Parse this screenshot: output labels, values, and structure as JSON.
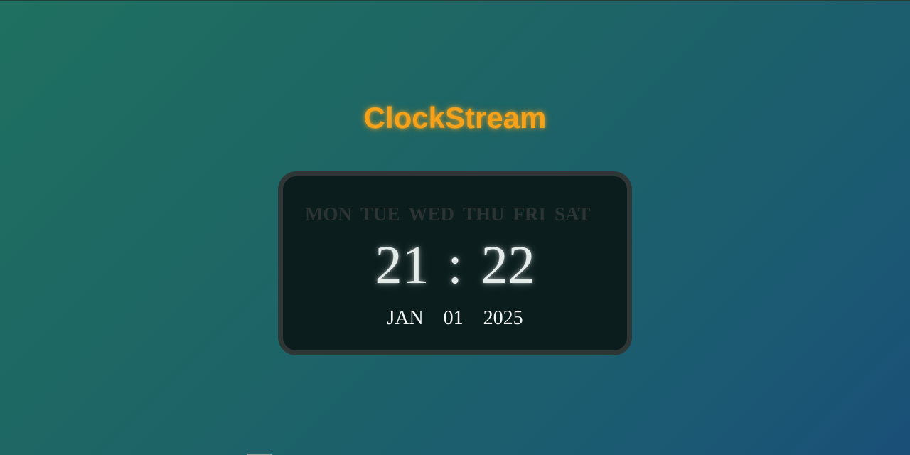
{
  "app": {
    "title": "ClockStream"
  },
  "clock": {
    "days": [
      "MON",
      "TUE",
      "WED",
      "THU",
      "FRI",
      "SAT"
    ],
    "time": {
      "hours": "21",
      "separator": ":",
      "minutes": "22"
    },
    "date": {
      "month": "JAN",
      "day": "01",
      "year": "2025"
    }
  },
  "colors": {
    "title": "#f5a21a",
    "panel": "#0b1d1d",
    "panel_border": "#2f3636",
    "inactive_day": "#2c3333",
    "time_text": "#e4ecea",
    "background_start": "#1f7060",
    "background_end": "#1a4f78"
  }
}
